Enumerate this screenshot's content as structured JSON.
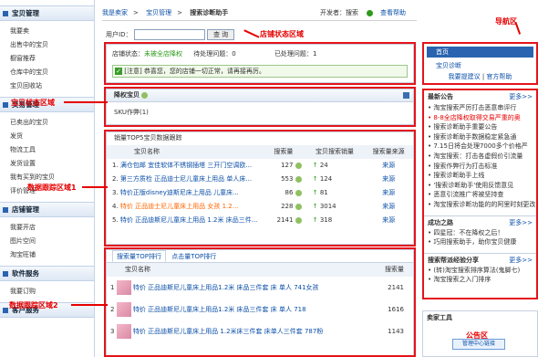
{
  "sidebar": {
    "sections": [
      {
        "title": "宝贝管理",
        "items": [
          "我要卖",
          "出售中的宝贝",
          "橱窗推荐",
          "仓库中的宝贝",
          "宝贝回收站"
        ]
      },
      {
        "title": "交易管理",
        "items": [
          "已卖出的宝贝",
          "发货",
          "物流工具",
          "发货设置",
          "我有买到的宝贝",
          "评价管理"
        ]
      },
      {
        "title": "店铺管理",
        "items": [
          "我要开店",
          "图片空间",
          "淘宝旺铺"
        ]
      },
      {
        "title": "软件服务",
        "items": [
          "我要订购"
        ]
      },
      {
        "title": "客户服务",
        "items": []
      }
    ],
    "floating_item": "宝贝回收站"
  },
  "breadcrumb": {
    "items": [
      "我是卖家",
      "宝贝管理",
      "搜索诊断助手"
    ],
    "sep": ">",
    "developer": "开发者：搜索",
    "help": "查看帮助"
  },
  "search": {
    "label": "用户ID：",
    "button": "查 询"
  },
  "shop_status": {
    "label_status": "店铺状态：",
    "status_value": "未被全店降权",
    "label_pending": "待处理问题：",
    "pending_value": "0",
    "label_done": "已处理问题：",
    "done_value": "1",
    "notice": "[注意] 恭喜您，您的店铺一切正常，请再接再厉。"
  },
  "demoted": {
    "title": "降权宝贝",
    "body": "SKU作弊(1)"
  },
  "sales_top5": {
    "title": "销量TOP5宝贝数据跟踪",
    "columns": [
      "宝贝名称",
      "搜索量",
      "宝贝搜索销量",
      "搜索量来源"
    ],
    "rows": [
      {
        "name": "满仓包邮 宜佳软体不锈钢插塔 三开门空调欧...",
        "search": "127",
        "sales": "24",
        "src": "来源"
      },
      {
        "name": "第三方质检 正品迪士尼儿童床上用品 单人床...",
        "search": "553",
        "sales": "124",
        "src": "来源"
      },
      {
        "name": "特价正版disney迪斯尼床上用品 儿童床...",
        "search": "86",
        "sales": "81",
        "src": "来源"
      },
      {
        "name": "特价 正品迪士尼儿童床上用品 女孩 1.2...",
        "search": "228",
        "sales": "3014",
        "src": "来源"
      },
      {
        "name": "特价 正品迪斯尼儿童床上用品 1.2米 床品三件...",
        "search": "2141",
        "sales": "318",
        "src": "来源"
      }
    ]
  },
  "search_top": {
    "tabs": [
      "搜索量TOP排行",
      "点击量TOP排行"
    ],
    "columns": [
      "宝贝名称",
      "搜索量"
    ],
    "rows": [
      {
        "rank": "1",
        "name": "特价 正品迪斯尼儿童床上用品1.2米 床品三件套 床 单人 741女孩",
        "value": "2141"
      },
      {
        "rank": "2",
        "name": "特价 正品迪斯尼儿童床上用品1.2米 床品三件套 床 单人 718",
        "value": "1616"
      },
      {
        "rank": "3",
        "name": "特价 正品迪斯尼儿童床上用品 1.2米床三件套 床单人三件套 787粉",
        "value": "1143"
      }
    ]
  },
  "right": {
    "nav": {
      "items": [
        "首页",
        "宝贝诊断"
      ],
      "links": [
        "我要提建议",
        "官方帮助"
      ]
    },
    "notice": {
      "title": "最新公告",
      "more": "更多>>",
      "items": [
        "淘宝搜索严厉打击恶意串评行",
        "8-8全店降权取得交易严重的奥",
        "搜索诊断助手重要公告",
        "搜索诊断助手数据稳定紧急通",
        "7.15日将会处理7000多个价格严",
        "淘宝搜索：打击各虚假价引流量",
        "搜索作弊行为打击标准",
        "搜索诊断助手上线",
        "'搜索诊断助手'使用反馈意见",
        "恶意引流推广将被坚持查",
        "淘宝搜索诊断功能的的阿里时刻更改"
      ]
    },
    "cases": {
      "title": "成功之路",
      "more": "更多>>",
      "items": [
        "四星冠：不在降权之后！",
        "巧用搜索助手，助你宝贝健康"
      ]
    },
    "share": {
      "title": "搜索帮派经验分享",
      "more": "更多>>",
      "items": [
        "(转)淘宝搜索排序算法(鬼脚七)",
        "淘宝搜索之入门排序"
      ]
    },
    "tools": {
      "title": "卖家工具",
      "logo_text": "管理中心链接"
    }
  },
  "annotations": {
    "shop_status": "店铺状态区域",
    "nav": "导航区",
    "demoted": "宝贝状态区域",
    "sales": "数据跟踪区域1",
    "ranking": "数据跟踪区域2",
    "notice": "公告区"
  }
}
